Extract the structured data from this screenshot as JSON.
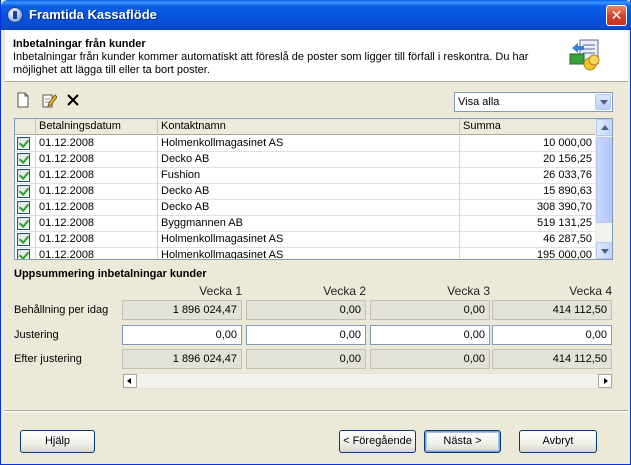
{
  "window": {
    "title": "Framtida Kassaflöde"
  },
  "header": {
    "title": "Inbetalningar från kunder",
    "description": "Inbetalningar från kunder kommer automatiskt att föreslå de poster som ligger till förfall i reskontra. Du har möjlighet att lägga till eller ta bort poster."
  },
  "filter": {
    "value": "Visa alla"
  },
  "grid": {
    "columns": [
      "Betalningsdatum",
      "Kontaktnamn",
      "Summa"
    ],
    "rows": [
      {
        "date": "01.12.2008",
        "name": "Holmenkollmagasinet AS",
        "sum": "10 000,00"
      },
      {
        "date": "01.12.2008",
        "name": "Decko AB",
        "sum": "20 156,25"
      },
      {
        "date": "01.12.2008",
        "name": "Fushion",
        "sum": "26 033,76"
      },
      {
        "date": "01.12.2008",
        "name": "Decko AB",
        "sum": "15 890,63"
      },
      {
        "date": "01.12.2008",
        "name": "Decko AB",
        "sum": "308 390,70"
      },
      {
        "date": "01.12.2008",
        "name": "Byggmannen AB",
        "sum": "519 131,25"
      },
      {
        "date": "01.12.2008",
        "name": "Holmenkollmagasinet AS",
        "sum": "46 287,50"
      },
      {
        "date": "01.12.2008",
        "name": "Holmenkollmagasinet AS",
        "sum": "195 000,00"
      }
    ]
  },
  "summary": {
    "title": "Uppsummering inbetalningar kunder",
    "weeks": [
      "Vecka 1",
      "Vecka 2",
      "Vecka 3",
      "Vecka 4"
    ],
    "rows": [
      {
        "label": "Behållning per idag",
        "values": [
          "1 896 024,47",
          "0,00",
          "0,00",
          "414 112,50"
        ]
      },
      {
        "label": "Justering",
        "values": [
          "0,00",
          "0,00",
          "0,00",
          "0,00"
        ]
      },
      {
        "label": "Efter justering",
        "values": [
          "1 896 024,47",
          "0,00",
          "0,00",
          "414 112,50"
        ]
      }
    ]
  },
  "buttons": {
    "help": "Hjälp",
    "back": "< Föregående",
    "next": "Nästa >",
    "cancel": "Avbryt"
  }
}
